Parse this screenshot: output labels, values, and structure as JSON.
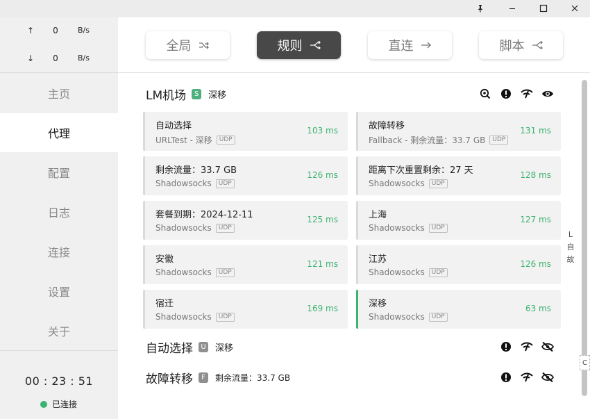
{
  "window": {
    "pin_icon": "pin-icon",
    "minimize_icon": "minimize-icon",
    "maximize_icon": "maximize-icon",
    "close_icon": "close-icon"
  },
  "traffic": {
    "up_arrow": "↑",
    "up_value": "0",
    "up_unit": "B/s",
    "down_arrow": "↓",
    "down_value": "0",
    "down_unit": "B/s"
  },
  "nav": {
    "items": [
      {
        "label": "主页"
      },
      {
        "label": "代理"
      },
      {
        "label": "配置"
      },
      {
        "label": "日志"
      },
      {
        "label": "连接"
      },
      {
        "label": "设置"
      },
      {
        "label": "关于"
      }
    ],
    "active": "代理"
  },
  "status": {
    "uptime": "00 : 23 : 51",
    "connection": "已连接",
    "connection_color": "#3cb371"
  },
  "modes": {
    "items": [
      {
        "label": "全局",
        "icon": "shuffle-icon"
      },
      {
        "label": "规则",
        "icon": "rule-split-icon"
      },
      {
        "label": "直连",
        "icon": "arrow-right-icon"
      },
      {
        "label": "脚本",
        "icon": "script-split-icon"
      }
    ],
    "active": "规则"
  },
  "groups": [
    {
      "name": "LM机场",
      "badge": "S",
      "current": "深移",
      "icons": [
        "locate-icon",
        "alert-icon",
        "speed-test-icon",
        "eye-icon"
      ],
      "proxies": [
        {
          "name": "自动选择",
          "type": "URLTest - 深移",
          "udp": "UDP",
          "delay": "103 ms"
        },
        {
          "name": "故障转移",
          "type": "Fallback - 剩余流量：33.7 GB",
          "udp": "UDP",
          "delay": "131 ms"
        },
        {
          "name": "剩余流量：33.7 GB",
          "type": "Shadowsocks",
          "udp": "UDP",
          "delay": "126 ms"
        },
        {
          "name": "距离下次重置剩余：27 天",
          "type": "Shadowsocks",
          "udp": "UDP",
          "delay": "128 ms"
        },
        {
          "name": "套餐到期：2024-12-11",
          "type": "Shadowsocks",
          "udp": "UDP",
          "delay": "125 ms"
        },
        {
          "name": "上海",
          "type": "Shadowsocks",
          "udp": "UDP",
          "delay": "127 ms"
        },
        {
          "name": "安徽",
          "type": "Shadowsocks",
          "udp": "UDP",
          "delay": "121 ms"
        },
        {
          "name": "江苏",
          "type": "Shadowsocks",
          "udp": "UDP",
          "delay": "126 ms"
        },
        {
          "name": "宿迁",
          "type": "Shadowsocks",
          "udp": "UDP",
          "delay": "169 ms"
        },
        {
          "name": "深移",
          "type": "Shadowsocks",
          "udp": "UDP",
          "delay": "63 ms",
          "selected": true
        }
      ]
    },
    {
      "name": "自动选择",
      "badge": "U",
      "current": "深移",
      "icons": [
        "alert-icon",
        "speed-test-icon",
        "eye-off-icon"
      ]
    },
    {
      "name": "故障转移",
      "badge": "F",
      "current": "剩余流量：33.7 GB",
      "icons": [
        "alert-icon",
        "speed-test-icon",
        "eye-off-icon"
      ]
    }
  ],
  "side_index": [
    "L",
    "自",
    "故"
  ],
  "side_tag": "C",
  "colors": {
    "accent_green": "#3cb371",
    "active_mode_bg": "#484848",
    "badge_s": "#4caf7c",
    "badge_gray": "#8f8f8f"
  }
}
